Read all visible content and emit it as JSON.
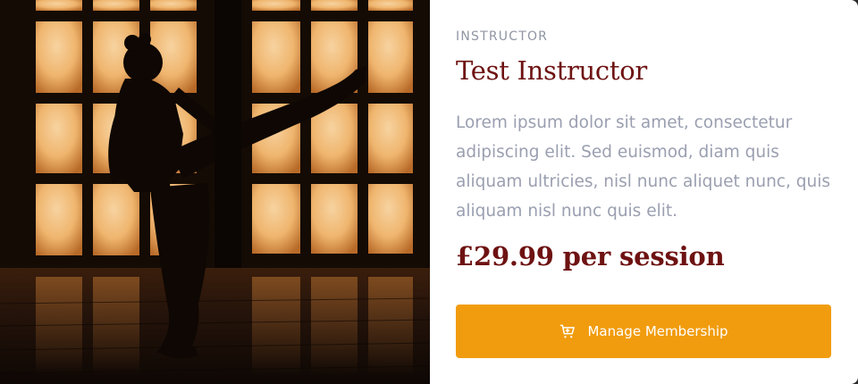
{
  "card": {
    "image": {
      "subject": "karate-kick-silhouette",
      "colors": {
        "window_glow": "#f4c98f",
        "window_glow_edge": "#d98c3c",
        "dark": "#140b05",
        "floor": "#2a160a"
      }
    },
    "eyebrow": "INSTRUCTOR",
    "title": "Test Instructor",
    "description": "Lorem ipsum dolor sit amet, consectetur adipiscing elit. Sed euismod, diam quis aliquam ultricies, nisl nunc aliquet nunc, quis aliquam nisl nunc quis elit.",
    "price": "£29.99 per session",
    "button": {
      "label": "Manage Membership",
      "icon": "cart-icon"
    }
  },
  "colors": {
    "accent": "#f19c0e",
    "title": "#6e1212",
    "muted_text": "#9a9fb0",
    "eyebrow": "#8f95a3"
  }
}
